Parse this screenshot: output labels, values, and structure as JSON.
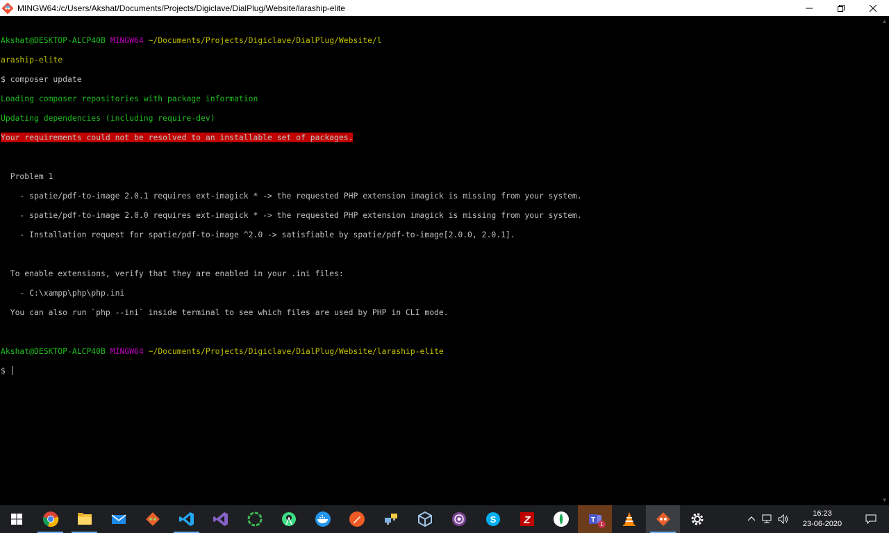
{
  "window": {
    "title": "MINGW64:/c/Users/Akshat/Documents/Projects/Digiclave/DialPlug/Website/laraship-elite"
  },
  "terminal": {
    "prompt1": {
      "user": "Akshat@DESKTOP-ALCP40B",
      "env": "MINGW64",
      "path_a": "~/Documents/Projects/Digiclave/DialPlug/Website/l",
      "path_b": "araship-elite"
    },
    "command": "$ composer update",
    "loading": "Loading composer repositories with package information",
    "updating": "Updating dependencies (including require-dev)",
    "error": "Your requirements could not be resolved to an installable set of packages.",
    "problem_title": "  Problem 1",
    "problem_lines": [
      "    - spatie/pdf-to-image 2.0.1 requires ext-imagick * -> the requested PHP extension imagick is missing from your system.",
      "    - spatie/pdf-to-image 2.0.0 requires ext-imagick * -> the requested PHP extension imagick is missing from your system.",
      "    - Installation request for spatie/pdf-to-image ^2.0 -> satisfiable by spatie/pdf-to-image[2.0.0, 2.0.1]."
    ],
    "enable_line": "  To enable extensions, verify that they are enabled in your .ini files:",
    "ini_path": "    - C:\\xampp\\php\\php.ini",
    "also_run": "  You can also run `php --ini` inside terminal to see which files are used by PHP in CLI mode.",
    "prompt2": {
      "user": "Akshat@DESKTOP-ALCP40B",
      "env": "MINGW64",
      "path": "~/Documents/Projects/Digiclave/DialPlug/Website/laraship-elite"
    },
    "cursor_prompt": "$ "
  },
  "taskbar": {
    "apps": [
      "chrome-icon",
      "file-explorer-icon",
      "mail-icon",
      "git-gui-icon",
      "vscode-icon",
      "visual-studio-icon",
      "refresh-circle-icon",
      "android-studio-icon",
      "docker-icon",
      "postman-icon",
      "network-manager-icon",
      "virtualbox-icon",
      "tor-icon",
      "skype-icon",
      "filezilla-icon",
      "mongodb-icon",
      "teams-icon",
      "vlc-icon",
      "git-bash-icon",
      "settings-icon"
    ],
    "teams_badge": "1",
    "time": "16:23",
    "date": "23-06-2020"
  },
  "colors": {
    "green": "#1fbf1f",
    "magenta": "#c000c0",
    "yellow": "#c0c000",
    "error_bg": "#c00000",
    "text": "#c0c0c0"
  }
}
